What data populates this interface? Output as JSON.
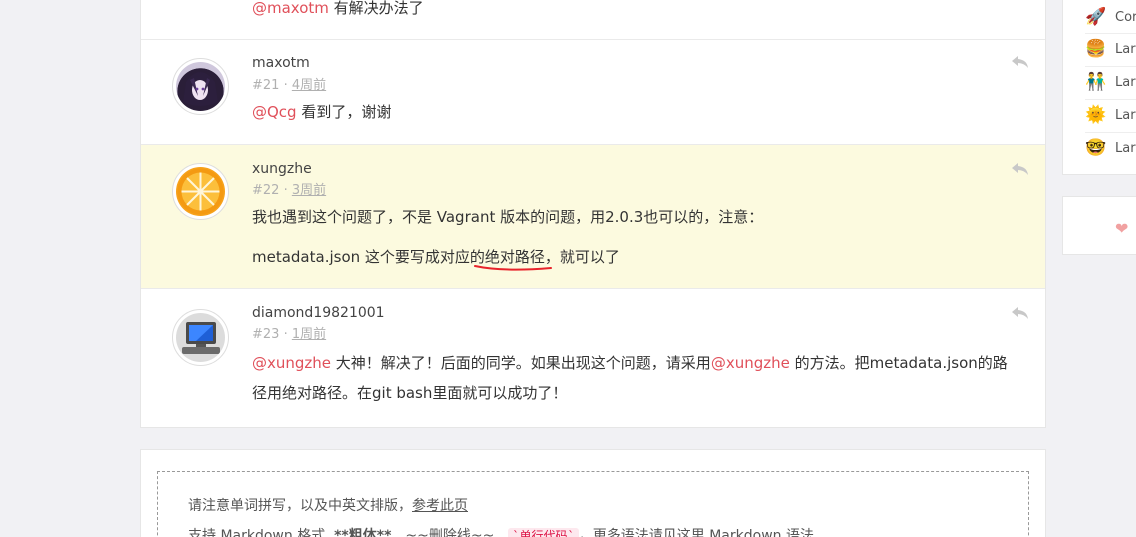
{
  "comments": [
    {
      "username": "",
      "floor": "",
      "time": "",
      "mention": "@maxotm",
      "text": " 有解决办法了"
    },
    {
      "username": "maxotm",
      "floor": "#21",
      "time": "4周前",
      "mention": "@Qcg",
      "text": " 看到了，谢谢"
    },
    {
      "username": "xungzhe",
      "floor": "#22",
      "time": "3周前",
      "line1": "我也遇到这个问题了，不是 Vagrant 版本的问题，用2.0.3也可以的，注意：",
      "line2": "metadata.json 这个要写成对应的绝对路径，就可以了"
    },
    {
      "username": "diamond19821001",
      "floor": "#23",
      "time": "1周前",
      "mention1": "@xungzhe",
      "text1": " 大神！解决了！后面的同学。如果出现这个问题，请采用",
      "mention2": "@xungzhe",
      "text2": " 的方法。把metadata.json的路",
      "line2": "径用绝对路径。在git bash里面就可以成功了！"
    }
  ],
  "meta_separator": " · ",
  "editor_tips": {
    "line1_text": "请注意单词拼写，以及中英文排版，",
    "line1_link": "参考此页",
    "line2_a": "支持 Markdown 格式, ",
    "line2_bold": "**粗体**",
    "line2_b": "、~~删除线~~、",
    "line2_code": "`单行代码`",
    "line2_c": "，更多语法请见这里 Markdown 语法"
  },
  "sidebar": {
    "items": [
      {
        "icon": "rocket-icon",
        "glyph": "🚀",
        "label": "Cor"
      },
      {
        "icon": "burger-icon",
        "glyph": "🍔",
        "label": "Lara"
      },
      {
        "icon": "people-icon",
        "glyph": "👬",
        "label": "Lara"
      },
      {
        "icon": "sun-icon",
        "glyph": "🌞",
        "label": "Lara"
      },
      {
        "icon": "nerd-face-icon",
        "glyph": "🤓",
        "label": "Lara"
      }
    ]
  },
  "like": {
    "glyph": "❤"
  }
}
